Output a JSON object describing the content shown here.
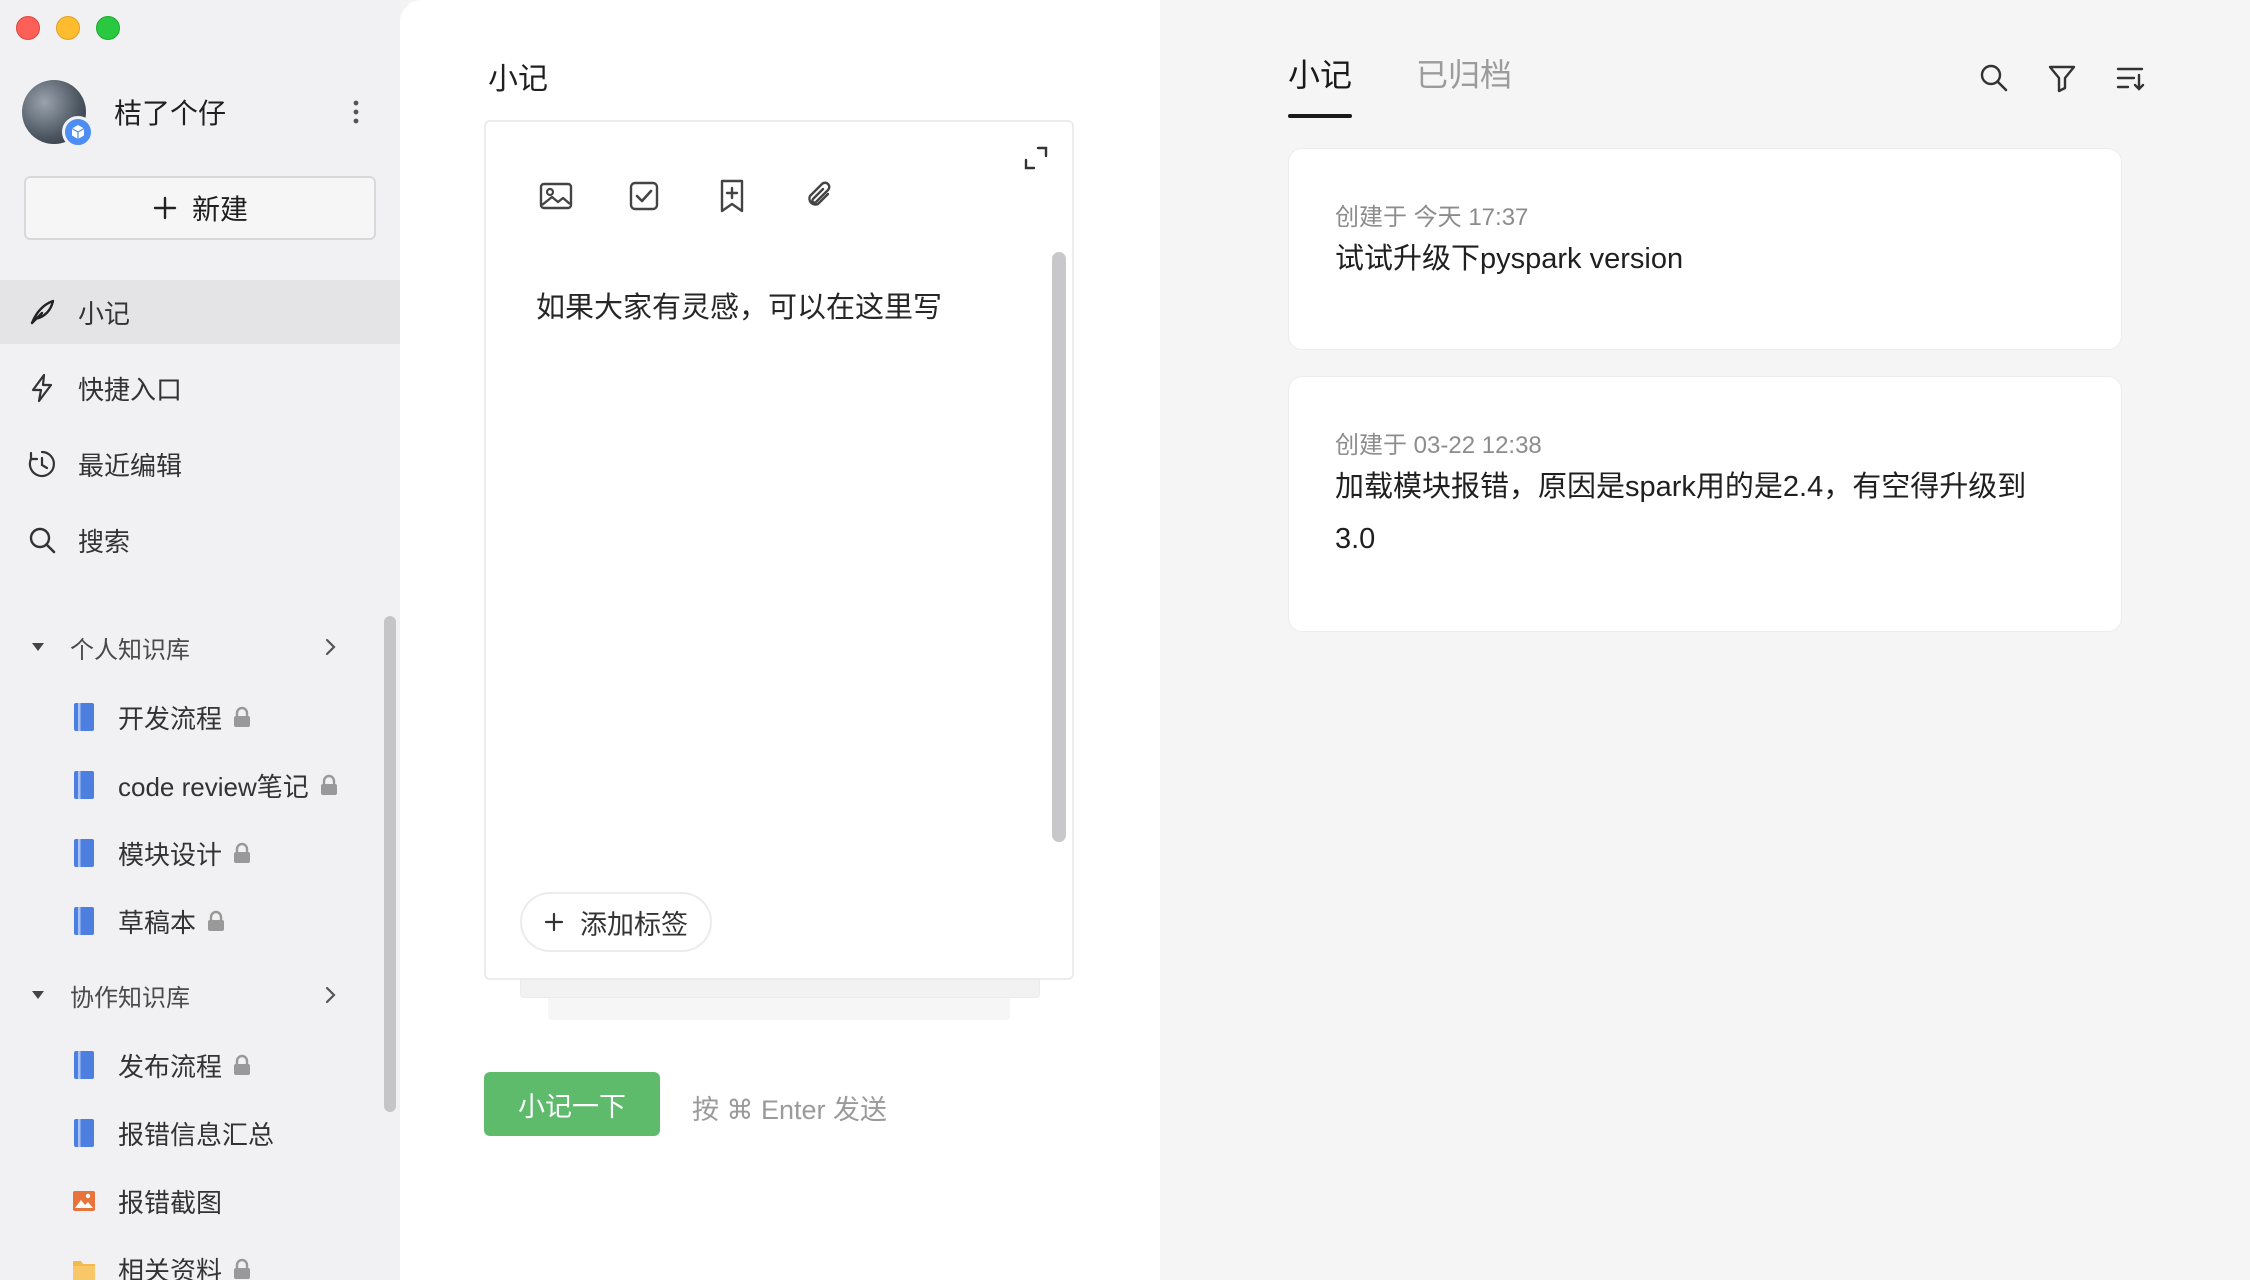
{
  "user": {
    "name": "桔了个仔"
  },
  "sidebar": {
    "new_label": "新建",
    "nav": [
      {
        "label": "小记",
        "icon": "feather-icon"
      },
      {
        "label": "快捷入口",
        "icon": "lightning-icon"
      },
      {
        "label": "最近编辑",
        "icon": "clock-icon"
      },
      {
        "label": "搜索",
        "icon": "search-icon"
      }
    ],
    "sections": [
      {
        "title": "个人知识库",
        "items": [
          {
            "label": "开发流程",
            "locked": true
          },
          {
            "label": "code review笔记",
            "locked": true
          },
          {
            "label": "模块设计",
            "locked": true
          },
          {
            "label": "草稿本",
            "locked": true
          }
        ]
      },
      {
        "title": "协作知识库",
        "items": [
          {
            "label": "发布流程",
            "locked": true
          },
          {
            "label": "报错信息汇总",
            "locked": false
          },
          {
            "label": "报错截图",
            "locked": false
          },
          {
            "label": "相关资料",
            "locked": true
          }
        ]
      }
    ]
  },
  "editor": {
    "title": "小记",
    "placeholder": "如果大家有灵感，可以在这里写",
    "add_tag": "添加标签",
    "submit": "小记一下",
    "hint": "按 ⌘ Enter 发送"
  },
  "list": {
    "tabs": [
      "小记",
      "已归档"
    ],
    "notes": [
      {
        "meta": "创建于 今天 17:37",
        "text": "试试升级下pyspark version"
      },
      {
        "meta": "创建于 03-22 12:38",
        "text": "加载模块报错，原因是spark用的是2.4，有空得升级到3.0"
      }
    ]
  },
  "colors": {
    "accent_green": "#5dbb6b",
    "book_blue": "#4c7fe0",
    "image_orange": "#e8743b",
    "folder_yellow": "#f5b84a"
  }
}
